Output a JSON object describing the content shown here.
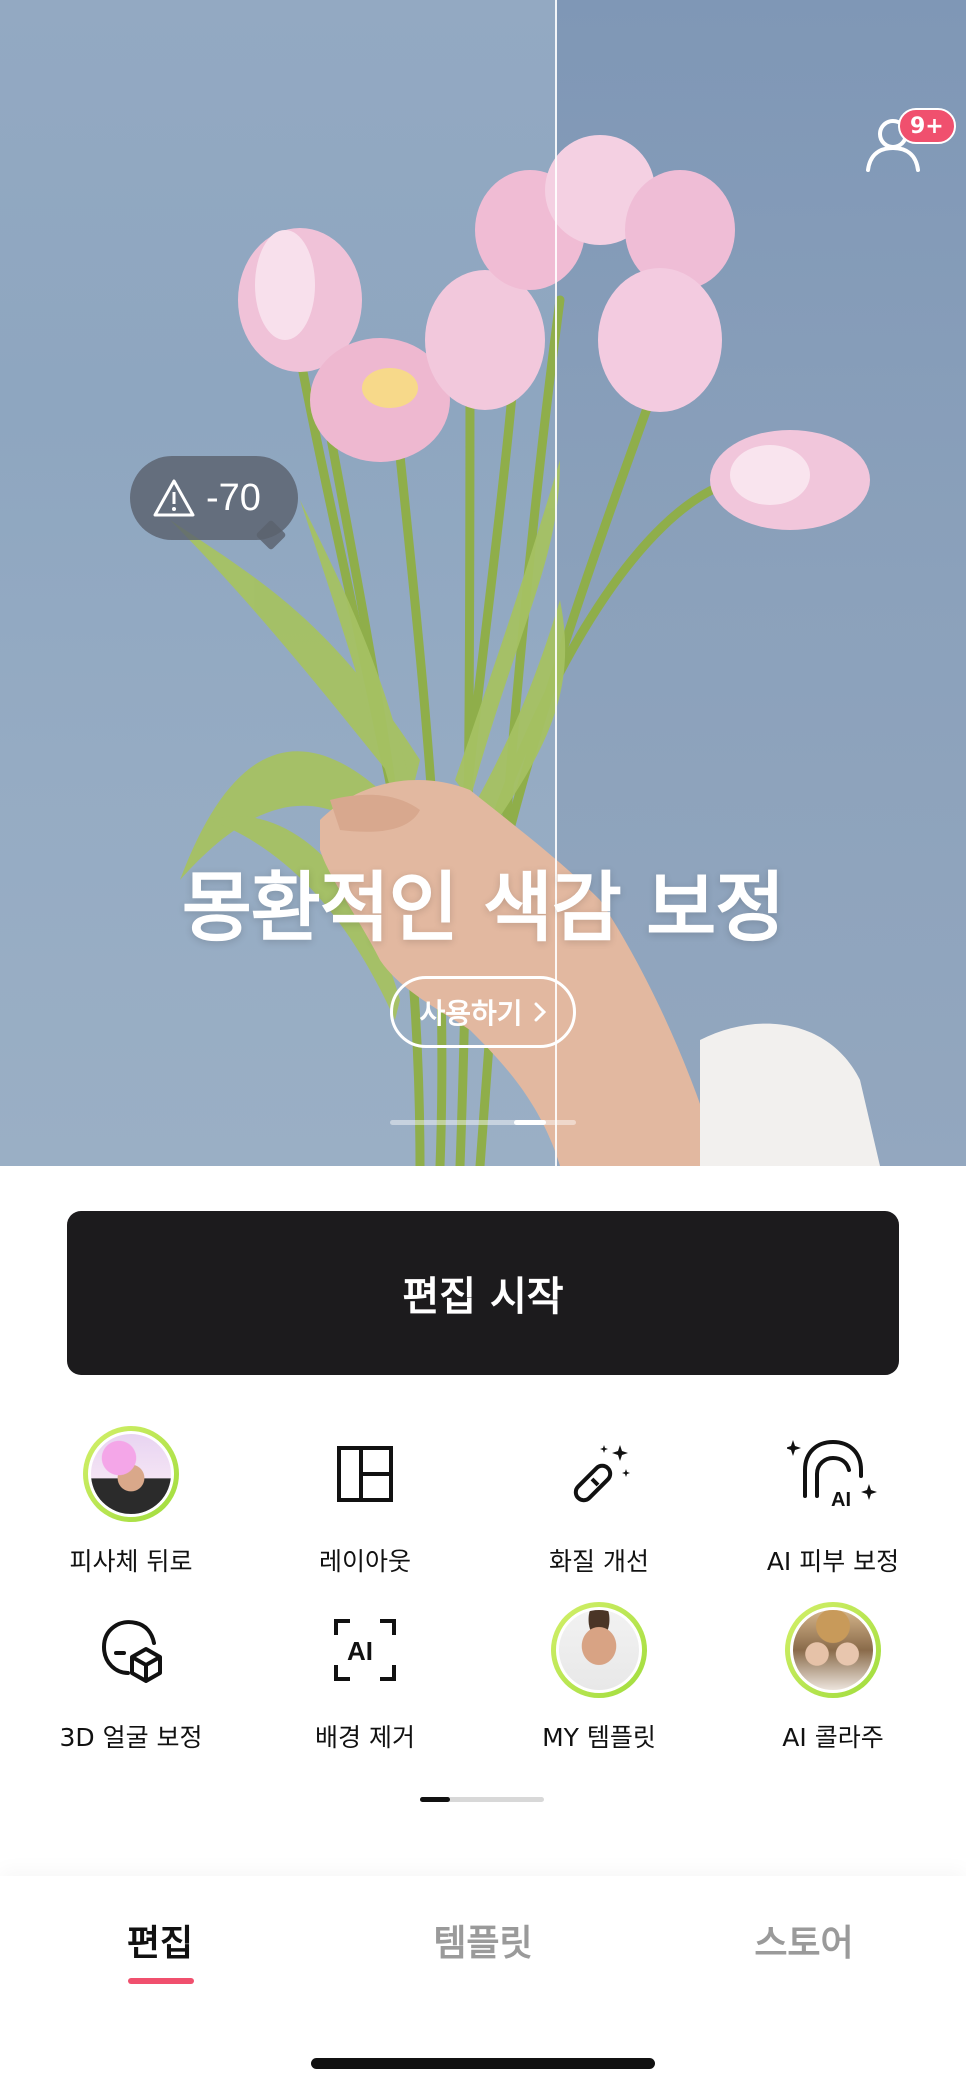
{
  "hero": {
    "title": "몽환적인 색감 보정",
    "use_button_label": "사용하기",
    "warning_value": "-70",
    "notification_badge": "9+",
    "carousel_pages": 6,
    "carousel_active_index": 4
  },
  "start_button_label": "편집 시작",
  "tools": [
    {
      "label": "피사체 뒤로",
      "icon": "subject-back-avatar"
    },
    {
      "label": "레이아웃",
      "icon": "layout-icon"
    },
    {
      "label": "화질 개선",
      "icon": "magic-wand-icon"
    },
    {
      "label": "AI 피부 보정",
      "icon": "ai-skin-icon"
    },
    {
      "label": "3D 얼굴 보정",
      "icon": "3d-face-icon"
    },
    {
      "label": "배경 제거",
      "icon": "ai-bg-remove-icon"
    },
    {
      "label": "MY 템플릿",
      "icon": "my-template-avatar"
    },
    {
      "label": "AI 콜라주",
      "icon": "ai-collage-avatar"
    }
  ],
  "nav": {
    "tabs": [
      {
        "label": "편집",
        "active": true
      },
      {
        "label": "템플릿",
        "active": false
      },
      {
        "label": "스토어",
        "active": false
      }
    ]
  },
  "colors": {
    "accent": "#f0506e",
    "dark_button": "#1c1b1d",
    "avatar_ring": "#a8e04a"
  }
}
